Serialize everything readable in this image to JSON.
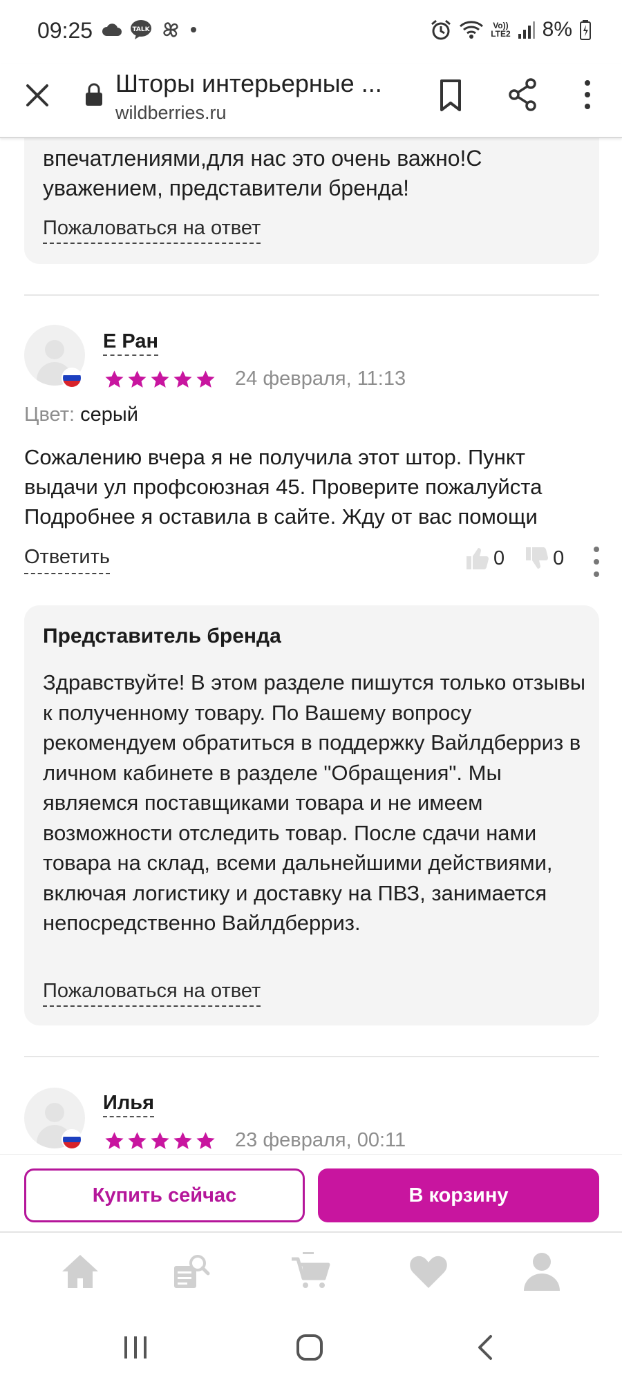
{
  "status_bar": {
    "time": "09:25",
    "battery": "8%",
    "network": "LTE2",
    "network_top": "Vo))",
    "icons": [
      "cloud-icon",
      "talk-icon",
      "pinwheel-icon",
      "dot-icon",
      "alarm-icon",
      "wifi-icon",
      "signal-icon",
      "battery-icon"
    ]
  },
  "browser": {
    "title": "Шторы интерьерные ...",
    "url": "wildberries.ru",
    "icons": [
      "close-icon",
      "lock-icon",
      "bookmark-icon",
      "share-icon",
      "more-vertical-icon"
    ]
  },
  "prev_answer": {
    "text": "впечатлениями,для нас это очень важно!С уважением, представители бренда!",
    "complain_label": "Пожаловаться на ответ"
  },
  "reviews": [
    {
      "name": "Е Ран",
      "rating": 5,
      "date": "24 февраля, 11:13",
      "color_label": "Цвет:",
      "color_value": "серый",
      "text": "Сожалению вчера я не получила этот штор. Пункт выдачи ул профсоюзная 45. Проверите пожалуйста Подробнее я оставила в сайте. Жду от вас помощи",
      "reply_label": "Ответить",
      "likes": "0",
      "dislikes": "0",
      "answer": {
        "author": "Представитель бренда",
        "text": "Здравствуйте! В этом разделе пишутся только отзывы к полученному товару. По Вашему вопросу рекомендуем обратиться в поддержку Вайлдберриз в личном кабинете в разделе \"Обращения\". Мы являемся поставщиками товара и не имеем возможности отследить товар. После сдачи нами товара на склад, всеми дальнейшими действиями, включая логистику и доставку на ПВЗ, занимается непосредственно Вайлдберриз.",
        "complain_label": "Пожаловаться на ответ"
      }
    },
    {
      "name": "Илья",
      "rating": 5,
      "date": "23 февраля, 00:11"
    }
  ],
  "actions": {
    "buy_now": "Купить сейчас",
    "to_cart": "В корзину"
  },
  "colors": {
    "brand": "#c8159f",
    "star": "#c8159f",
    "muted": "#8d8d8d",
    "card": "#f4f4f4"
  },
  "bottom_nav": [
    "home-icon",
    "catalog-search-icon",
    "cart-icon",
    "heart-icon",
    "profile-icon"
  ],
  "system_nav": [
    "recent-apps-icon",
    "home-button-icon",
    "back-icon"
  ]
}
